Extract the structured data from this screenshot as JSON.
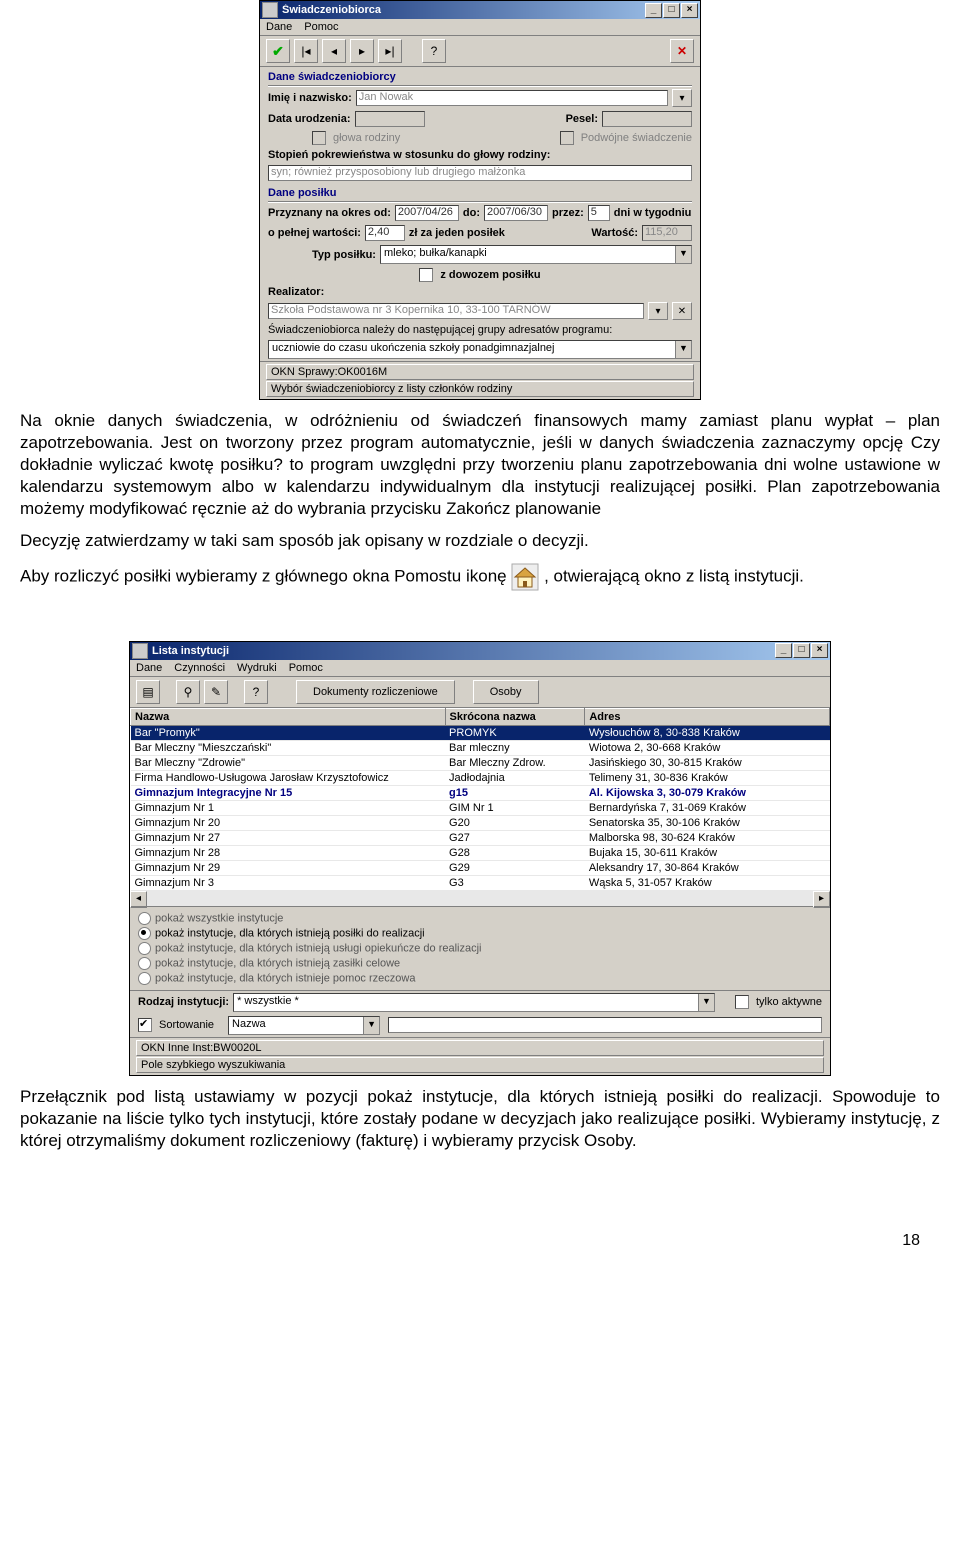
{
  "window1": {
    "title": "Świadczeniobiorca",
    "menu": [
      "Dane",
      "Pomoc"
    ],
    "groups": {
      "beneficiary_header": "Dane świadczeniobiorcy",
      "name_label": "Imię i nazwisko:",
      "name_value": "Jan Nowak",
      "dob_label": "Data urodzenia:",
      "pesel_label": "Pesel:",
      "head_cb": "głowa rodziny",
      "double_cb": "Podwójne świadczenie",
      "relation_label": "Stopień pokrewieństwa w stosunku do głowy rodziny:",
      "relation_value": "syn; również przysposobiony lub drugiego małżonka",
      "meal_header": "Dane posiłku",
      "period_from_label": "Przyznany na okres od:",
      "period_from": "2007/04/26",
      "period_to_label": "do:",
      "period_to": "2007/06/30",
      "by_label": "przez:",
      "by_value": "5",
      "by_suffix": "dni w tygodniu",
      "fullval_label": "o pełnej wartości:",
      "fullval": "2,40",
      "permeal_label": "zł za jeden posiłek",
      "worth_label": "Wartość:",
      "worth": "115,20",
      "mealtype_label": "Typ posiłku:",
      "mealtype": "mleko; bułka/kanapki",
      "delivery_cb": "z dowozem posiłku",
      "realizer_label": "Realizator:",
      "realizer": "Szkoła Podstawowa nr 3 Kopernika 10, 33-100 TARNÓW",
      "group_label": "Świadczeniobiorca należy do następującej grupy adresatów programu:",
      "group_value": "uczniowie do czasu ukończenia szkoły ponadgimnazjalnej",
      "okn": "OKN Sprawy:OK0016M",
      "footer": "Wybór świadczeniobiorcy z listy członków rodziny"
    }
  },
  "paragraph1": "Na oknie danych świadczenia, w odróżnieniu od świadczeń finansowych mamy zamiast planu wypłat – plan zapotrzebowania. Jest on tworzony przez program automatycznie, jeśli w danych świadczenia zaznaczymy opcję Czy dokładnie wyliczać kwotę posiłku? to program uwzględni przy tworzeniu planu zapotrzebowania dni wolne ustawione w kalendarzu systemowym albo w kalendarzu indywidualnym dla instytucji realizującej posiłki. Plan zapotrzebowania możemy modyfikować ręcznie aż do wybrania przycisku Zakończ planowanie",
  "paragraph2": "Decyzję zatwierdzamy w taki sam sposób jak opisany w rozdziale o decyzji.",
  "paragraph3_a": "Aby rozliczyć posiłki wybieramy z głównego okna Pomostu ikonę",
  "paragraph3_b": ", otwierającą okno z listą instytucji.",
  "window2": {
    "title": "Lista instytucji",
    "menu": [
      "Dane",
      "Czynności",
      "Wydruki",
      "Pomoc"
    ],
    "bigbtns": [
      "Dokumenty rozliczeniowe",
      "Osoby"
    ],
    "columns": [
      "Nazwa",
      "Skrócona nazwa",
      "Adres"
    ],
    "rows": [
      {
        "n": "Bar \"Promyk\"",
        "s": "PROMYK",
        "a": "Wysłouchów 8, 30-838 Kraków",
        "sel": true
      },
      {
        "n": "Bar Mleczny \"Mieszczański\"",
        "s": "Bar mleczny",
        "a": "Wiotowa 2, 30-668 Kraków"
      },
      {
        "n": "Bar Mleczny \"Zdrowie\"",
        "s": "Bar Mleczny Zdrow.",
        "a": "Jasińskiego 30, 30-815 Kraków"
      },
      {
        "n": "Firma Handlowo-Usługowa Jarosław Krzysztofowicz",
        "s": "Jadłodajnia",
        "a": "Telimeny 31, 30-836 Kraków"
      },
      {
        "n": "Gimnazjum Integracyjne Nr 15",
        "s": "g15",
        "a": "Al. Kijowska 3, 30-079 Kraków",
        "hl": true
      },
      {
        "n": "Gimnazjum Nr 1",
        "s": "GIM Nr 1",
        "a": "Bernardyńska 7, 31-069 Kraków"
      },
      {
        "n": "Gimnazjum Nr 20",
        "s": "G20",
        "a": "Senatorska 35, 30-106 Kraków"
      },
      {
        "n": "Gimnazjum Nr 27",
        "s": "G27",
        "a": "Malborska 98, 30-624 Kraków"
      },
      {
        "n": "Gimnazjum Nr 28",
        "s": "G28",
        "a": "Bujaka 15, 30-611 Kraków"
      },
      {
        "n": "Gimnazjum Nr 29",
        "s": "G29",
        "a": "Aleksandry 17, 30-864 Kraków"
      },
      {
        "n": "Gimnazjum Nr 3",
        "s": "G3",
        "a": "Wąska 5, 31-057 Kraków"
      }
    ],
    "filters": [
      "pokaż wszystkie instytucje",
      "pokaż instytucje, dla których istnieją posiłki do realizacji",
      "pokaż instytucje, dla których istnieją usługi opiekuńcze do realizacji",
      "pokaż instytucje, dla których istnieją zasiłki celowe",
      "pokaż instytucje, dla których istnieje pomoc rzeczowa"
    ],
    "inst_type_label": "Rodzaj instytucji:",
    "inst_type": "* wszystkie *",
    "only_active": "tylko aktywne",
    "sort_cb": "Sortowanie",
    "sort_value": "Nazwa",
    "okn": "OKN Inne Inst:BW0020L",
    "quicksearch": "Pole szybkiego wyszukiwania"
  },
  "paragraph4": "Przełącznik pod listą ustawiamy w pozycji pokaż instytucje, dla których istnieją posiłki do realizacji. Spowoduje to pokazanie na liście tylko tych instytucji, które zostały podane w decyzjach jako realizujące posiłki. Wybieramy instytucję, z której otrzymaliśmy dokument rozliczeniowy (fakturę) i wybieramy przycisk Osoby.",
  "page_number": "18"
}
